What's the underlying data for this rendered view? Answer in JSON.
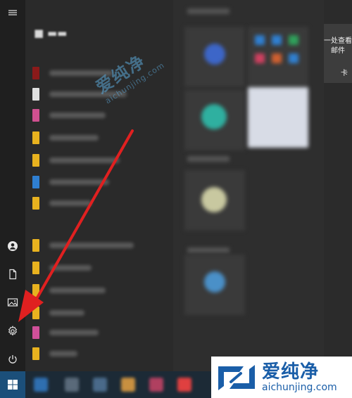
{
  "side_card": {
    "line1": "一处查看",
    "line2": "邮件",
    "tail": "卡"
  },
  "watermark": {
    "title": "爱纯净",
    "url": "aichunjing.com"
  },
  "logo": {
    "cn": "爱纯净",
    "en": "aichunjing.com"
  },
  "left_rail": [
    "menu-icon",
    "user-icon",
    "document-icon",
    "pictures-icon",
    "settings-icon",
    "power-icon"
  ],
  "annotation": {
    "type": "red-arrow",
    "color": "#e02020",
    "target": "settings-icon"
  },
  "colors": {
    "start_bg": "#1b4f7a",
    "taskbar_bg": "#1c2a36",
    "rail_bg": "#1f1f1f",
    "accent": "#1a5ea8"
  }
}
